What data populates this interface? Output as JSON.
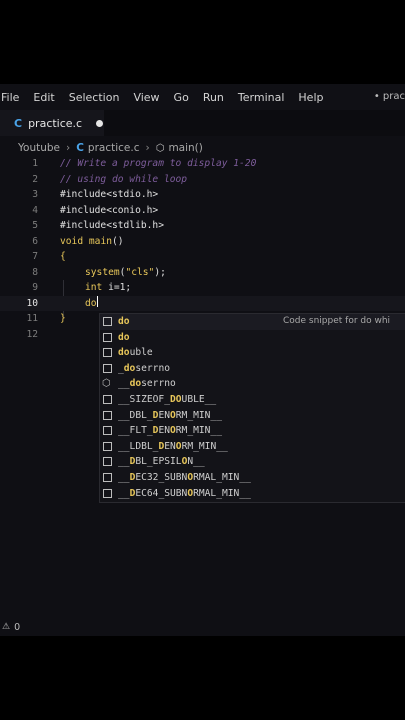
{
  "menubar": {
    "items": [
      "File",
      "Edit",
      "Selection",
      "View",
      "Go",
      "Run",
      "Terminal",
      "Help"
    ],
    "window_title": "• prac"
  },
  "tab": {
    "label": "practice.c",
    "icon": "C"
  },
  "breadcrumb": {
    "folder": "Youtube",
    "file": "practice.c",
    "symbol": "main()"
  },
  "code": {
    "lines": [
      {
        "num": "1"
      },
      {
        "num": "2"
      },
      {
        "num": "3"
      },
      {
        "num": "4"
      },
      {
        "num": "5"
      },
      {
        "num": "6"
      },
      {
        "num": "7"
      },
      {
        "num": "8"
      },
      {
        "num": "9"
      },
      {
        "num": "10"
      },
      {
        "num": "11"
      },
      {
        "num": "12"
      }
    ],
    "l1_comment": "// Write a program to display 1-20",
    "l2_comment": "// using do while loop",
    "l3": "#include<stdio.h>",
    "l4": "#include<conio.h>",
    "l5": "#include<stdlib.h>",
    "l6_type": "void",
    "l6_name": "main",
    "l6_parens": "()",
    "l7": "{",
    "l8_fn": "system",
    "l8_open": "(",
    "l8_str": "\"cls\"",
    "l8_close": ");",
    "l9_type": "int",
    "l9_rest": " i=1;",
    "l10": "do",
    "l11": "}"
  },
  "suggestions": {
    "items": [
      {
        "pre": "",
        "match": "do",
        "post": "",
        "detail": "Code snippet for do whi",
        "icon": "snippet-icon"
      },
      {
        "pre": "",
        "match": "do",
        "post": "",
        "detail": "",
        "icon": "keyword-icon"
      },
      {
        "pre": "",
        "match": "do",
        "post": "uble",
        "detail": "",
        "icon": "keyword-icon"
      },
      {
        "pre": "_",
        "match": "do",
        "post": "serrno",
        "detail": "",
        "icon": "keyword-icon"
      },
      {
        "pre": "__",
        "match": "do",
        "post": "serrno",
        "detail": "",
        "icon": "cube-icon"
      },
      {
        "pre": "__SIZEOF_",
        "match": "DO",
        "post": "UBLE__",
        "detail": "",
        "icon": "keyword-icon"
      },
      {
        "pre": "__DBL_",
        "match": "D",
        "post": "EN",
        "post2": "O",
        "post3": "RM_MIN__",
        "detail": "",
        "icon": "keyword-icon"
      },
      {
        "pre": "__FLT_",
        "match": "D",
        "post": "EN",
        "post2": "O",
        "post3": "RM_MIN__",
        "detail": "",
        "icon": "keyword-icon"
      },
      {
        "pre": "__LDBL_",
        "match": "D",
        "post": "EN",
        "post2": "O",
        "post3": "RM_MIN__",
        "detail": "",
        "icon": "keyword-icon"
      },
      {
        "pre": "__",
        "match": "D",
        "post": "BL_EPSIL",
        "post2": "O",
        "post3": "N__",
        "detail": "",
        "icon": "keyword-icon"
      },
      {
        "pre": "__",
        "match": "D",
        "post": "EC32_SUBN",
        "post2": "O",
        "post3": "RMAL_MIN__",
        "detail": "",
        "icon": "keyword-icon"
      },
      {
        "pre": "__",
        "match": "D",
        "post": "EC64_SUBN",
        "post2": "O",
        "post3": "RMAL_MIN__",
        "detail": "",
        "icon": "keyword-icon"
      }
    ]
  },
  "status": {
    "warnings_icon": "warning-icon",
    "warnings_count": "0"
  },
  "colors": {
    "accent": "#e8c75a",
    "comment": "#7e5d9c",
    "file_icon": "#4aa3e8"
  }
}
